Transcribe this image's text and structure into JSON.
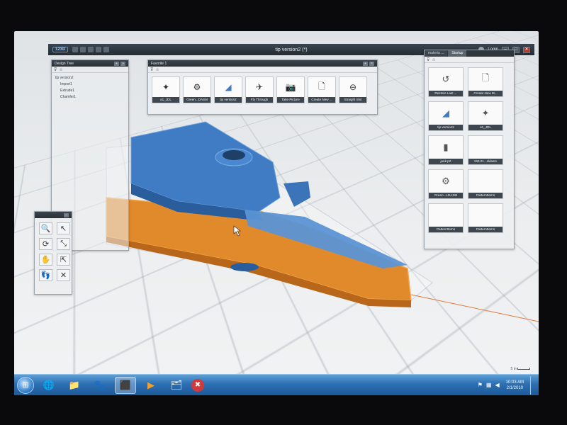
{
  "window": {
    "app_badge": "123D",
    "title": "tip version2 (*)",
    "login_label": "Login",
    "min_glyph": "–",
    "max_glyph": "□",
    "close_glyph": "✕"
  },
  "design_tree": {
    "title": "Design Tree",
    "items": [
      {
        "label": "tip version2",
        "indent": 0
      },
      {
        "label": "Import1",
        "indent": 1
      },
      {
        "label": "Extrude1",
        "indent": 1
      },
      {
        "label": "Chamfer1",
        "indent": 1
      }
    ]
  },
  "favorites": {
    "title": "Favorite 1",
    "tiles": [
      {
        "label": "a1_JDL",
        "icon": "✦"
      },
      {
        "label": "Green...DASM",
        "icon": "⚙"
      },
      {
        "label": "tip version2",
        "icon": "◢"
      },
      {
        "label": "Fly Through",
        "icon": "✈"
      },
      {
        "label": "Take Picture",
        "icon": "📷"
      },
      {
        "label": "Create New ...",
        "icon": "🗋"
      },
      {
        "label": "Straight Slot",
        "icon": "⊖"
      }
    ]
  },
  "startup": {
    "tabs": [
      "materia ...",
      "Startup"
    ],
    "tiles": [
      {
        "label": "Restore Last ...",
        "icon": "↺"
      },
      {
        "label": "Create New M...",
        "icon": "🗋"
      },
      {
        "label": "tip version2",
        "icon": "◢"
      },
      {
        "label": "a1_JDL",
        "icon": "✦"
      },
      {
        "label": "junk.prt",
        "icon": "▮"
      },
      {
        "label": "150.01...sldasm",
        "icon": ""
      },
      {
        "label": "Green...LDASM",
        "icon": "⚙"
      },
      {
        "label": "PatternItems",
        "icon": ""
      },
      {
        "label": "PatternItems",
        "icon": ""
      },
      {
        "label": "PatternItems",
        "icon": ""
      }
    ]
  },
  "nav_tools": [
    {
      "name": "zoom",
      "icon": "🔍"
    },
    {
      "name": "select",
      "icon": "↖"
    },
    {
      "name": "orbit",
      "icon": "⟳"
    },
    {
      "name": "select-multi",
      "icon": "⤡"
    },
    {
      "name": "pan",
      "icon": "✋"
    },
    {
      "name": "move",
      "icon": "⇱"
    },
    {
      "name": "look",
      "icon": "👣"
    },
    {
      "name": "close-tools",
      "icon": "✕"
    }
  ],
  "taskbar": {
    "start_glyph": "⊞",
    "apps": [
      "🌐",
      "📁",
      "🐾",
      "⬛",
      "▶",
      "🗂",
      "✖"
    ],
    "time": "10:03 AM",
    "date": "2/1/2010"
  },
  "viewport": {
    "scale_label": "5 in",
    "model_colors": {
      "top": "#3f7cc4",
      "side": "#e08a2c",
      "dark": "#254f85"
    }
  }
}
